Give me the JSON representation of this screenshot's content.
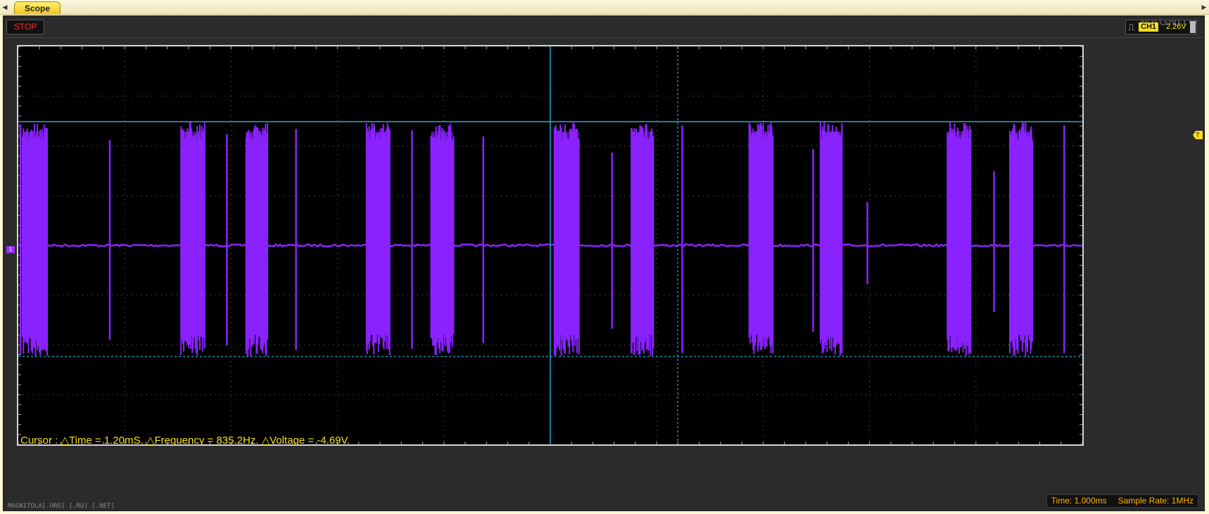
{
  "tab": {
    "label": "Scope"
  },
  "nav": {
    "left_arrow": "◀",
    "right_arrow": "▶"
  },
  "toolbar": {
    "stop_label": "STOP",
    "trigger_channel": "CH1",
    "trigger_level": "2.26V",
    "trigger_icon": "rising-edge-icon",
    "watermark": "MAGNITOLA"
  },
  "markers": {
    "channel": "1",
    "trigger": "T"
  },
  "cursor_readout": "Cursor : △Time = 1.20mS. △Frequency = 835.2Hz. △Voltage = -4.69V.",
  "status": {
    "time_div": "Time: 1.000ms",
    "sample_rate": "Sample Rate: 1MHz"
  },
  "bottom_watermark": "MAGNITOLA[.ORG] [.RU] [.NET]",
  "colors": {
    "trace": "#8a22ff",
    "cursor": "#2aa7d6",
    "grid_border": "#d6d6d6",
    "accent": "#f6e01c",
    "readout": "#f6e01c",
    "status": "#ffb300"
  },
  "scope": {
    "bursts": [
      {
        "start": 0.04,
        "width": 0.23,
        "amp": 1.0,
        "lines": 26
      },
      {
        "start": 1.53,
        "width": 0.22,
        "amp": 1.0,
        "lines": 26
      },
      {
        "start": 2.14,
        "width": 0.2,
        "amp": 1.0,
        "lines": 24
      },
      {
        "start": 3.27,
        "width": 0.22,
        "amp": 1.0,
        "lines": 26
      },
      {
        "start": 3.88,
        "width": 0.21,
        "amp": 1.0,
        "lines": 24
      },
      {
        "start": 5.04,
        "width": 0.23,
        "amp": 1.0,
        "lines": 26
      },
      {
        "start": 5.76,
        "width": 0.21,
        "amp": 1.0,
        "lines": 24
      },
      {
        "start": 6.87,
        "width": 0.22,
        "amp": 1.0,
        "lines": 26
      },
      {
        "start": 7.54,
        "width": 0.2,
        "amp": 1.0,
        "lines": 24
      },
      {
        "start": 8.73,
        "width": 0.22,
        "amp": 1.0,
        "lines": 26
      },
      {
        "start": 9.32,
        "width": 0.21,
        "amp": 1.0,
        "lines": 24
      }
    ],
    "spikes": [
      {
        "t": 0.02,
        "amp": 0.98
      },
      {
        "t": 0.26,
        "amp": 0.95
      },
      {
        "t": 0.86,
        "amp": 0.85
      },
      {
        "t": 1.96,
        "amp": 0.9
      },
      {
        "t": 2.61,
        "amp": 0.94
      },
      {
        "t": 3.7,
        "amp": 0.93
      },
      {
        "t": 4.37,
        "amp": 0.88
      },
      {
        "t": 5.58,
        "amp": 0.75
      },
      {
        "t": 6.24,
        "amp": 0.97
      },
      {
        "t": 7.47,
        "amp": 0.78
      },
      {
        "t": 7.98,
        "amp": 0.35
      },
      {
        "t": 9.17,
        "amp": 0.6
      },
      {
        "t": 9.83,
        "amp": 0.97
      }
    ]
  }
}
